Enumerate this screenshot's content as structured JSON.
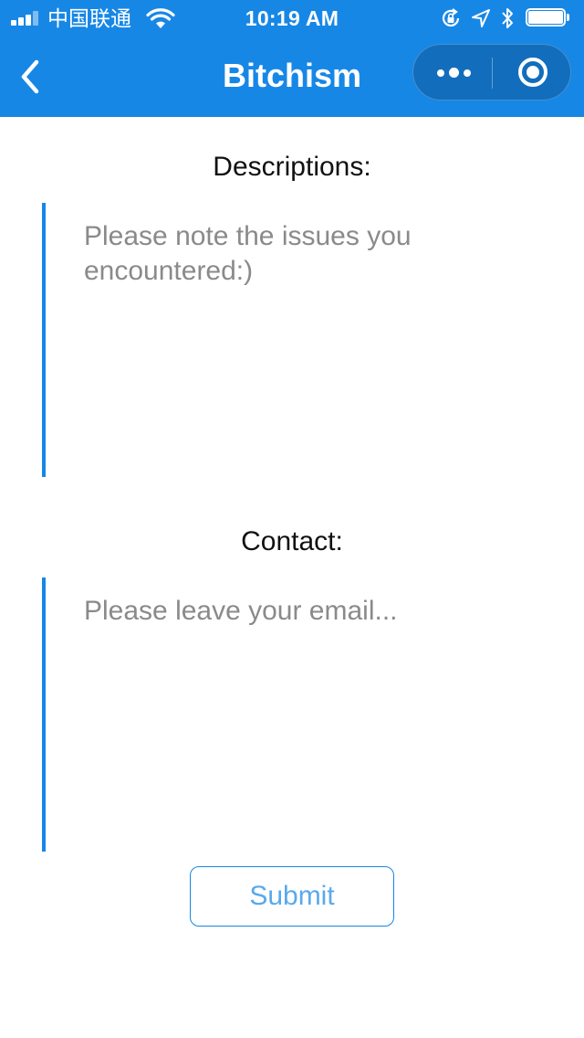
{
  "status_bar": {
    "carrier": "中国联通",
    "time": "10:19 AM",
    "icons": [
      "signal-icon",
      "wifi-icon",
      "rotation-lock-icon",
      "location-arrow-icon",
      "bluetooth-icon",
      "battery-icon"
    ],
    "battery_level": 1.0
  },
  "nav": {
    "title": "Bitchism",
    "back_icon": "chevron-left-icon",
    "more_icon": "more-dots-icon",
    "close_icon": "target-circle-icon"
  },
  "form": {
    "description_label": "Descriptions:",
    "description_placeholder": "Please note the issues you encountered:)",
    "description_value": "",
    "contact_label": "Contact:",
    "contact_placeholder": "Please leave your email...",
    "contact_value": "",
    "submit_label": "Submit"
  },
  "colors": {
    "brand": "#1787e6",
    "placeholder": "#8a8a8a",
    "submit_text": "#5aa9ec"
  }
}
